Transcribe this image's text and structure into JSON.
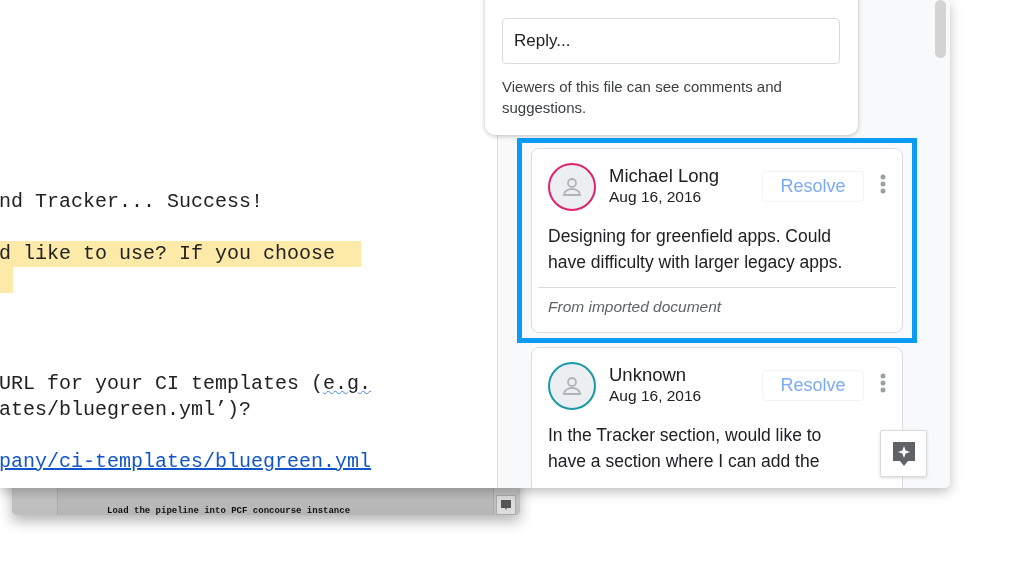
{
  "document": {
    "lines": [
      {
        "kind": "blank"
      },
      {
        "kind": "text",
        "segments": [
          {
            "text": "nd Tracker... Success!"
          }
        ]
      },
      {
        "kind": "blank"
      },
      {
        "kind": "highlight",
        "segments": [
          {
            "text": "d like to use? If you choose "
          }
        ]
      },
      {
        "kind": "highlight-tail"
      },
      {
        "kind": "blank"
      },
      {
        "kind": "blank"
      },
      {
        "kind": "blank"
      },
      {
        "kind": "text",
        "segments": [
          {
            "text": "URL for your CI templates ("
          },
          {
            "text": "e.g.",
            "misspelled": true
          }
        ]
      },
      {
        "kind": "text",
        "segments": [
          {
            "text": "ates/bluegreen.yml’)?"
          }
        ]
      },
      {
        "kind": "blank"
      },
      {
        "kind": "link",
        "segments": [
          {
            "text": "pany/ci-templates/bluegreen.yml"
          }
        ]
      }
    ]
  },
  "back_window": {
    "text": "Load the pipeline into PCF concourse instance"
  },
  "reply": {
    "placeholder": "Reply...",
    "notice": "Viewers of this file can see comments and suggestions."
  },
  "comments": [
    {
      "author": "Michael Long",
      "date": "Aug 16, 2016",
      "color": "#e0226e",
      "resolve": "Resolve",
      "text": "Designing for greenfield apps. Could have difficulty with larger legacy apps.",
      "footer": "From imported document",
      "selected": true
    },
    {
      "author": "Unknown",
      "date": "Aug 16, 2016",
      "color": "#1a9aa8",
      "resolve": "Resolve",
      "text": "In the Tracker section, would like to have a section where I can add the",
      "selected": false
    }
  ]
}
